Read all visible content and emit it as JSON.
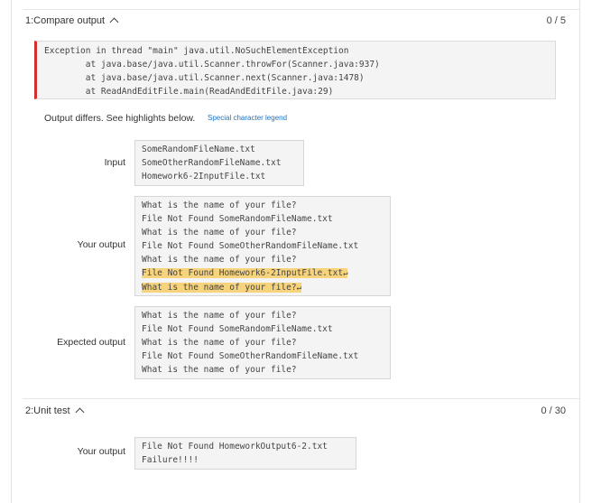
{
  "compare": {
    "title": "1:Compare output",
    "score": "0 / 5",
    "exception_lines": [
      "Exception in thread \"main\" java.util.NoSuchElementException",
      "        at java.base/java.util.Scanner.throwFor(Scanner.java:937)",
      "        at java.base/java.util.Scanner.next(Scanner.java:1478)",
      "        at ReadAndEditFile.main(ReadAndEditFile.java:29)"
    ],
    "diff_note": "Output differs. See highlights below.",
    "legend_link": "Special character legend",
    "input_label": "Input",
    "input_lines": [
      "SomeRandomFileName.txt",
      "SomeOtherRandomFileName.txt",
      "Homework6-2InputFile.txt"
    ],
    "your_output_label": "Your output",
    "your_output_lines": [
      "What is the name of your file?",
      "File Not Found SomeRandomFileName.txt",
      "What is the name of your file?",
      "File Not Found SomeOtherRandomFileName.txt",
      "What is the name of your file?"
    ],
    "your_output_highlight_lines": [
      "File Not Found Homework6-2InputFile.txt",
      "What is the name of your file?"
    ],
    "return_symbol": "↵",
    "expected_output_label": "Expected output",
    "expected_output_lines": [
      "What is the name of your file?",
      "File Not Found SomeRandomFileName.txt",
      "What is the name of your file?",
      "File Not Found SomeOtherRandomFileName.txt",
      "What is the name of your file?"
    ]
  },
  "unit": {
    "title": "2:Unit test",
    "score": "0 / 30",
    "your_output_label": "Your output",
    "output_lines": [
      "File Not Found HomeworkOutput6-2.txt",
      "Failure!!!!"
    ]
  },
  "colors": {
    "error_bar": "#d32f2f",
    "highlight": "#f7d37c",
    "link": "#1b74c7"
  }
}
